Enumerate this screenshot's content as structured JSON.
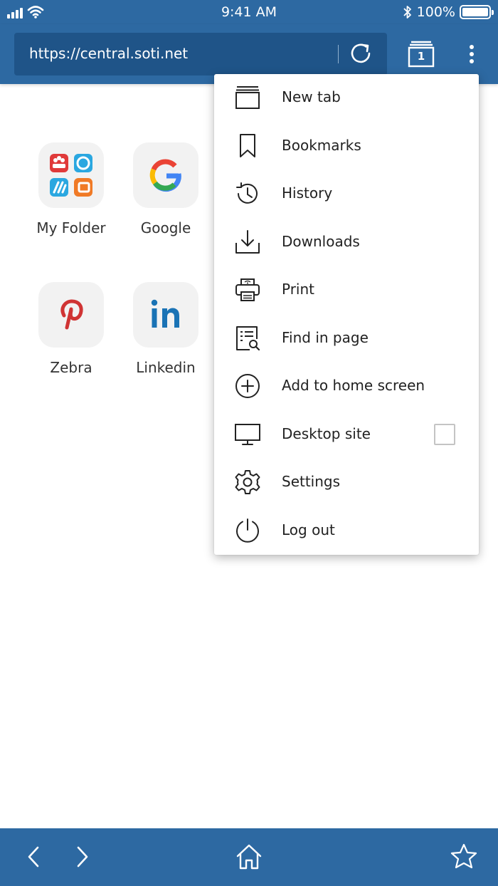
{
  "status_bar": {
    "time": "9:41 AM",
    "battery_text": "100%"
  },
  "toolbar": {
    "url": "https://central.soti.net",
    "tab_count": "1"
  },
  "shortcuts": [
    {
      "label": "My Folder",
      "icon": "my-folder-icon"
    },
    {
      "label": "Google",
      "icon": "google-icon"
    },
    {
      "label": "Zebra",
      "icon": "pinterest-icon"
    },
    {
      "label": "Linkedin",
      "icon": "linkedin-icon"
    }
  ],
  "menu": {
    "items": [
      {
        "label": "New tab",
        "icon": "new-tab-icon"
      },
      {
        "label": "Bookmarks",
        "icon": "bookmark-icon"
      },
      {
        "label": "History",
        "icon": "history-icon"
      },
      {
        "label": "Downloads",
        "icon": "download-icon"
      },
      {
        "label": "Print",
        "icon": "print-icon"
      },
      {
        "label": "Find in page",
        "icon": "find-in-page-icon"
      },
      {
        "label": "Add to home screen",
        "icon": "add-circle-icon"
      },
      {
        "label": "Desktop site",
        "icon": "desktop-icon",
        "checked": false
      },
      {
        "label": "Settings",
        "icon": "gear-icon"
      },
      {
        "label": "Log out",
        "icon": "power-icon"
      }
    ]
  },
  "colors": {
    "bar": "#2d69a2",
    "url_field": "#1f5488"
  }
}
